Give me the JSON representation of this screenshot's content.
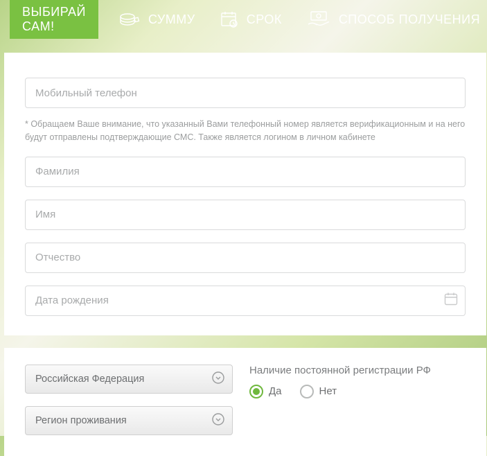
{
  "header": {
    "choose_label": "ВЫБИРАЙ САМ!",
    "steps": [
      {
        "label": "СУММУ"
      },
      {
        "label": "СРОК"
      },
      {
        "label": "СПОСОБ ПОЛУЧЕНИЯ"
      }
    ]
  },
  "form": {
    "phone_placeholder": "Мобильный телефон",
    "phone_note": "* Обращаем Ваше внимание, что указанный Вами телефонный номер является верификационным и на него будут отправлены подтверждающие СМС. Также является логином в личном кабинете",
    "surname_placeholder": "Фамилия",
    "name_placeholder": "Имя",
    "patronymic_placeholder": "Отчество",
    "dob_placeholder": "Дата рождения"
  },
  "lower": {
    "country_select": "Российская Федерация",
    "region_select": "Регион проживания",
    "reg_label": "Наличие постоянной регистрации РФ",
    "yes_label": "Да",
    "no_label": "Нет",
    "registration_value": "Да"
  }
}
